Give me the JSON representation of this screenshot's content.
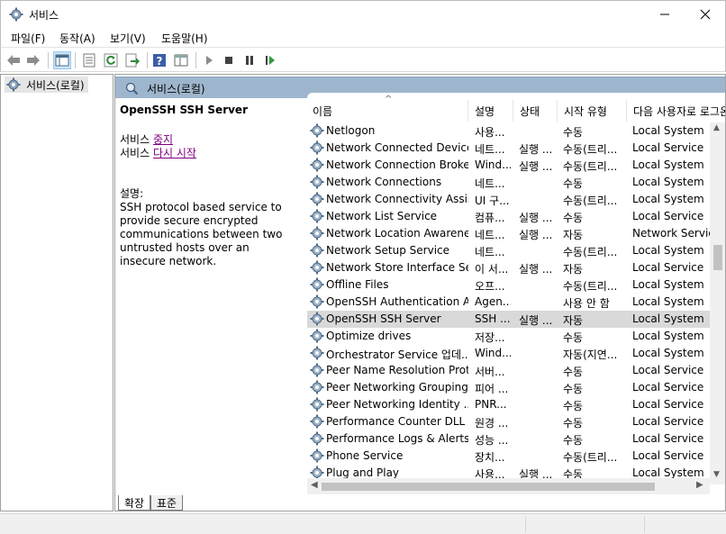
{
  "window": {
    "title": "서비스",
    "icon": "gear-icon"
  },
  "menu": [
    "파일(F)",
    "동작(A)",
    "보기(V)",
    "도움말(H)"
  ],
  "toolbar": {
    "icons": [
      "back-arrow-icon",
      "forward-arrow-icon",
      "console-tree-icon",
      "properties-icon",
      "refresh-icon",
      "export-icon",
      "help-icon",
      "details-view-icon",
      "start-service-icon",
      "stop-service-icon",
      "pause-service-icon",
      "restart-service-icon"
    ]
  },
  "tree": {
    "root_label": "서비스(로컬)"
  },
  "panel": {
    "header_label": "서비스(로컬)",
    "selected_service": "OpenSSH SSH Server",
    "link_prefix": "서비스",
    "stop_link": "중지",
    "restart_link": "다시 시작",
    "desc_label": "설명:",
    "description": "SSH protocol based service to provide secure encrypted communications between two untrusted hosts over an insecure network."
  },
  "table": {
    "columns": [
      "이름",
      "설명",
      "상태",
      "시작 유형",
      "다음 사용자로 로그온"
    ],
    "rows": [
      {
        "name": "Netlogon",
        "desc": "사용...",
        "status": "",
        "start": "수동",
        "logon": "Local System"
      },
      {
        "name": "Network Connected Device...",
        "desc": "네트...",
        "status": "실행 ...",
        "start": "수동(트리...",
        "logon": "Local Service"
      },
      {
        "name": "Network Connection Broker",
        "desc": "Wind...",
        "status": "실행 ...",
        "start": "수동(트리...",
        "logon": "Local System"
      },
      {
        "name": "Network Connections",
        "desc": "네트...",
        "status": "",
        "start": "수동",
        "logon": "Local System"
      },
      {
        "name": "Network Connectivity Assis...",
        "desc": "UI 구...",
        "status": "",
        "start": "수동(트리...",
        "logon": "Local System"
      },
      {
        "name": "Network List Service",
        "desc": "컴퓨...",
        "status": "실행 ...",
        "start": "수동",
        "logon": "Local Service"
      },
      {
        "name": "Network Location Awareness",
        "desc": "네트...",
        "status": "실행 ...",
        "start": "자동",
        "logon": "Network Service"
      },
      {
        "name": "Network Setup Service",
        "desc": "네트...",
        "status": "",
        "start": "수동(트리...",
        "logon": "Local System"
      },
      {
        "name": "Network Store Interface Se...",
        "desc": "이 서...",
        "status": "실행 ...",
        "start": "자동",
        "logon": "Local Service"
      },
      {
        "name": "Offline Files",
        "desc": "오프...",
        "status": "",
        "start": "수동(트리...",
        "logon": "Local System"
      },
      {
        "name": "OpenSSH Authentication A...",
        "desc": "Agen...",
        "status": "",
        "start": "사용 안 함",
        "logon": "Local System"
      },
      {
        "name": "OpenSSH SSH Server",
        "desc": "SSH ...",
        "status": "실행 ...",
        "start": "자동",
        "logon": "Local System",
        "selected": true
      },
      {
        "name": "Optimize drives",
        "desc": "저장...",
        "status": "",
        "start": "수동",
        "logon": "Local System"
      },
      {
        "name": "Orchestrator Service 업데...",
        "desc": "Wind...",
        "status": "",
        "start": "자동(지연...",
        "logon": "Local System"
      },
      {
        "name": "Peer Name Resolution Prot...",
        "desc": "서버...",
        "status": "",
        "start": "수동",
        "logon": "Local Service"
      },
      {
        "name": "Peer Networking Grouping",
        "desc": "피어 ...",
        "status": "",
        "start": "수동",
        "logon": "Local Service"
      },
      {
        "name": "Peer Networking Identity ...",
        "desc": "PNR...",
        "status": "",
        "start": "수동",
        "logon": "Local Service"
      },
      {
        "name": "Performance Counter DLL ...",
        "desc": "원경 ...",
        "status": "",
        "start": "수동",
        "logon": "Local Service"
      },
      {
        "name": "Performance Logs & Alerts",
        "desc": "성능 ...",
        "status": "",
        "start": "수동",
        "logon": "Local Service"
      },
      {
        "name": "Phone Service",
        "desc": "장치...",
        "status": "",
        "start": "수동(트리...",
        "logon": "Local Service"
      },
      {
        "name": "Plug and Play",
        "desc": "사용...",
        "status": "실행 ...",
        "start": "수동",
        "logon": "Local System"
      }
    ]
  },
  "tabs": [
    "확장",
    "표준"
  ]
}
